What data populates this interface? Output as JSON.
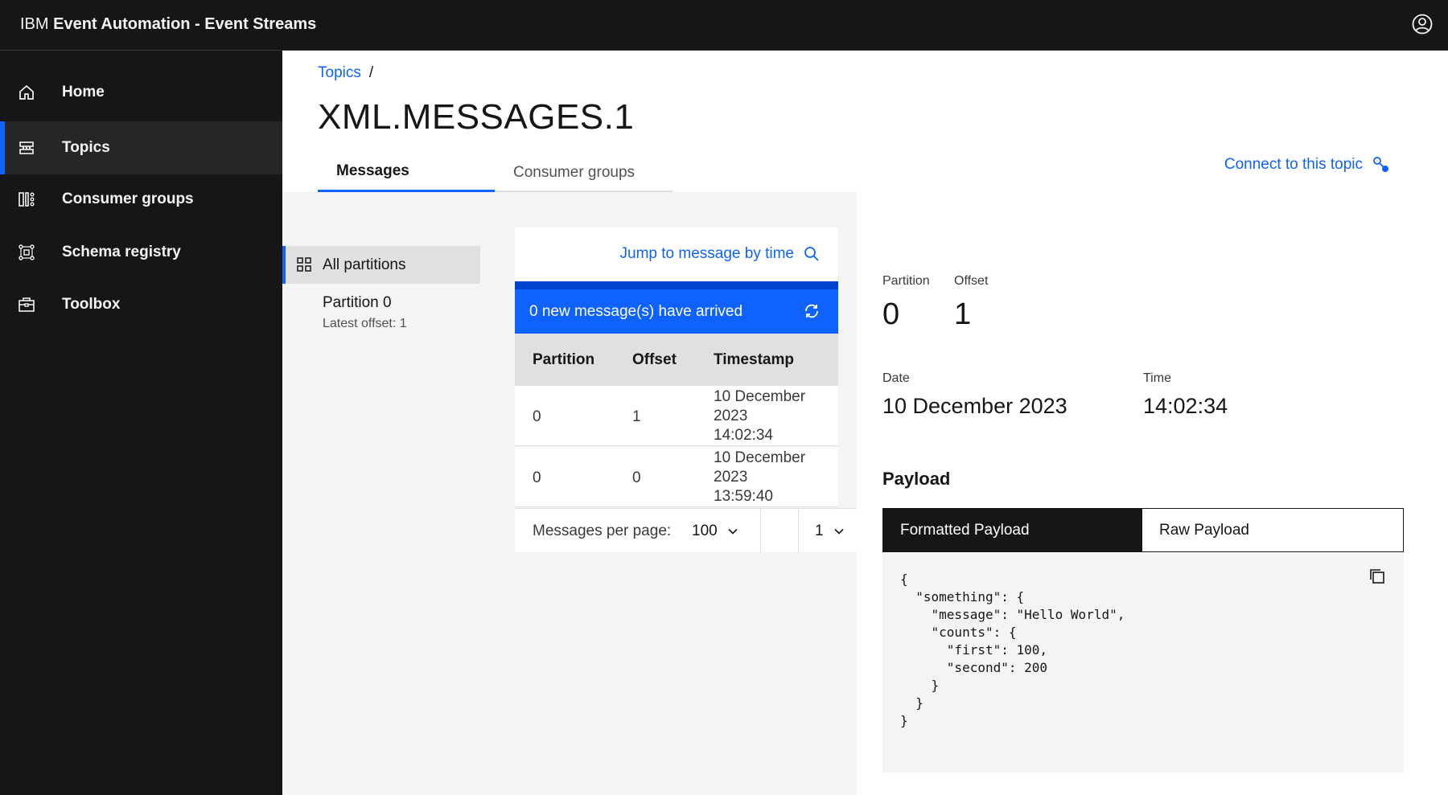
{
  "header": {
    "brand_ibm": "IBM",
    "brand_product": "Event Automation - Event Streams"
  },
  "sidebar": {
    "items": [
      {
        "label": "Home",
        "icon": "home-icon"
      },
      {
        "label": "Topics",
        "icon": "topics-icon",
        "active": true
      },
      {
        "label": "Consumer groups",
        "icon": "consumer-groups-icon"
      },
      {
        "label": "Schema registry",
        "icon": "schema-registry-icon"
      },
      {
        "label": "Toolbox",
        "icon": "toolbox-icon"
      }
    ]
  },
  "breadcrumb": {
    "link": "Topics",
    "separator": "/"
  },
  "page_title": "XML.MESSAGES.1",
  "tabs": [
    {
      "label": "Messages",
      "active": true
    },
    {
      "label": "Consumer groups",
      "active": false
    }
  ],
  "connect_link": "Connect to this topic",
  "partitions": {
    "all_label": "All partitions",
    "items": [
      {
        "label": "Partition 0",
        "sub": "Latest offset: 1"
      }
    ]
  },
  "messages": {
    "jump_label": "Jump to message by time",
    "notice": "0 new message(s) have arrived",
    "columns": [
      "Partition",
      "Offset",
      "Timestamp"
    ],
    "rows": [
      {
        "partition": "0",
        "offset": "1",
        "ts_line1": "10 December",
        "ts_line2": "2023",
        "ts_line3": "14:02:34"
      },
      {
        "partition": "0",
        "offset": "0",
        "ts_line1": "10 December",
        "ts_line2": "2023",
        "ts_line3": "13:59:40"
      }
    ],
    "per_page_label": "Messages per page:",
    "per_page_value": "100",
    "page_value": "1"
  },
  "detail": {
    "partition_label": "Partition",
    "partition_value": "0",
    "offset_label": "Offset",
    "offset_value": "1",
    "date_label": "Date",
    "date_value": "10 December 2023",
    "time_label": "Time",
    "time_value": "14:02:34",
    "payload_title": "Payload",
    "formatted_tab": "Formatted Payload",
    "raw_tab": "Raw Payload",
    "payload_text": "{\n  \"something\": {\n    \"message\": \"Hello World\",\n    \"counts\": {\n      \"first\": 100,\n      \"second\": 200\n    }\n  }\n}"
  },
  "colors": {
    "accent": "#0f62fe",
    "header_bg": "#161616",
    "sidebar_active": "#262626",
    "content_bg": "#f4f4f4"
  }
}
